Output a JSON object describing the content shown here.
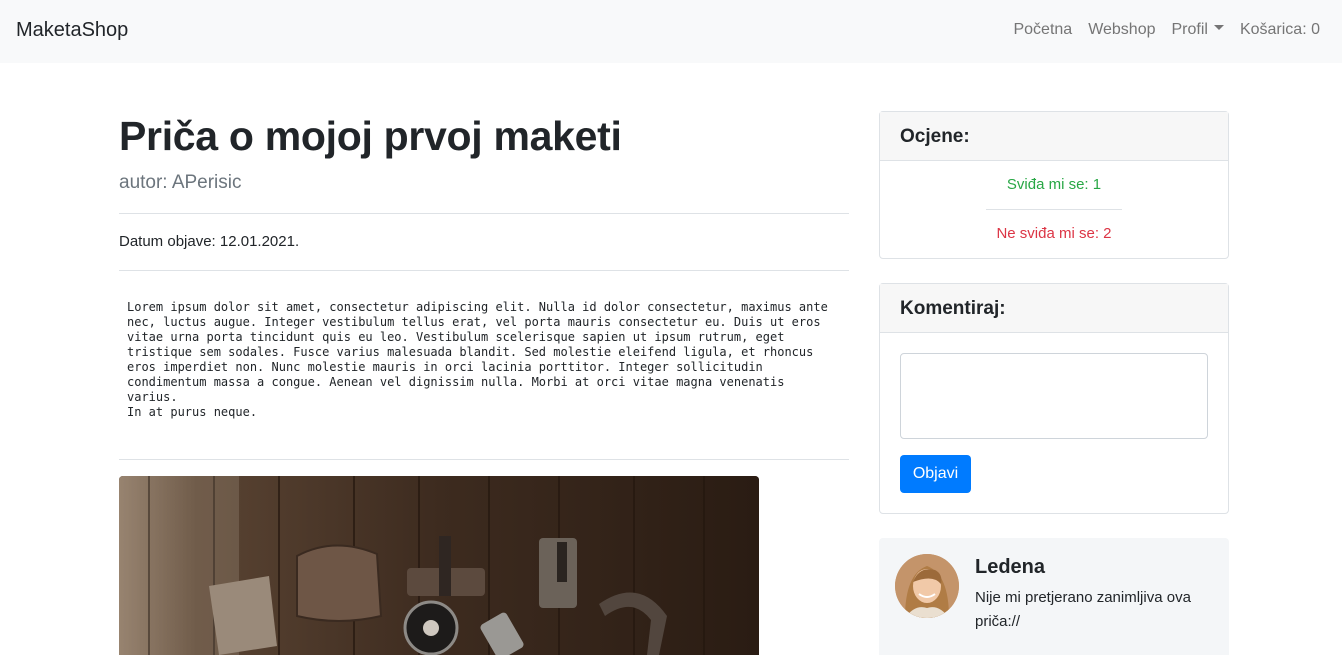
{
  "navbar": {
    "brand": "MaketaShop",
    "items": [
      {
        "label": "Početna"
      },
      {
        "label": "Webshop"
      },
      {
        "label": "Profil"
      },
      {
        "label": "Košarica: 0"
      }
    ]
  },
  "article": {
    "title": "Priča o mojoj prvoj maketi",
    "author": "autor: APerisic",
    "date": "Datum objave: 12.01.2021.",
    "body": "Lorem ipsum dolor sit amet, consectetur adipiscing elit. Nulla id dolor consectetur, maximus ante\nnec, luctus augue. Integer vestibulum tellus erat, vel porta mauris consectetur eu. Duis ut eros\nvitae urna porta tincidunt quis eu leo. Vestibulum scelerisque sapien ut ipsum rutrum, eget\ntristique sem sodales. Fusce varius malesuada blandit. Sed molestie eleifend ligula, et rhoncus\neros imperdiet non. Nunc molestie mauris in orci lacinia porttitor. Integer sollicitudin\ncondimentum massa a congue. Aenean vel dignissim nulla. Morbi at orci vitae magna venenatis varius.\nIn at purus neque."
  },
  "ratings": {
    "header": "Ocjene:",
    "like": "Sviđa mi se: 1",
    "dislike": "Ne sviđa mi se: 2"
  },
  "comment_form": {
    "header": "Komentiraj:",
    "value": "",
    "submit_label": "Objavi"
  },
  "comments": [
    {
      "author": "Ledena",
      "text": "Nije mi pretjerano zanimljiva ova priča://"
    }
  ]
}
